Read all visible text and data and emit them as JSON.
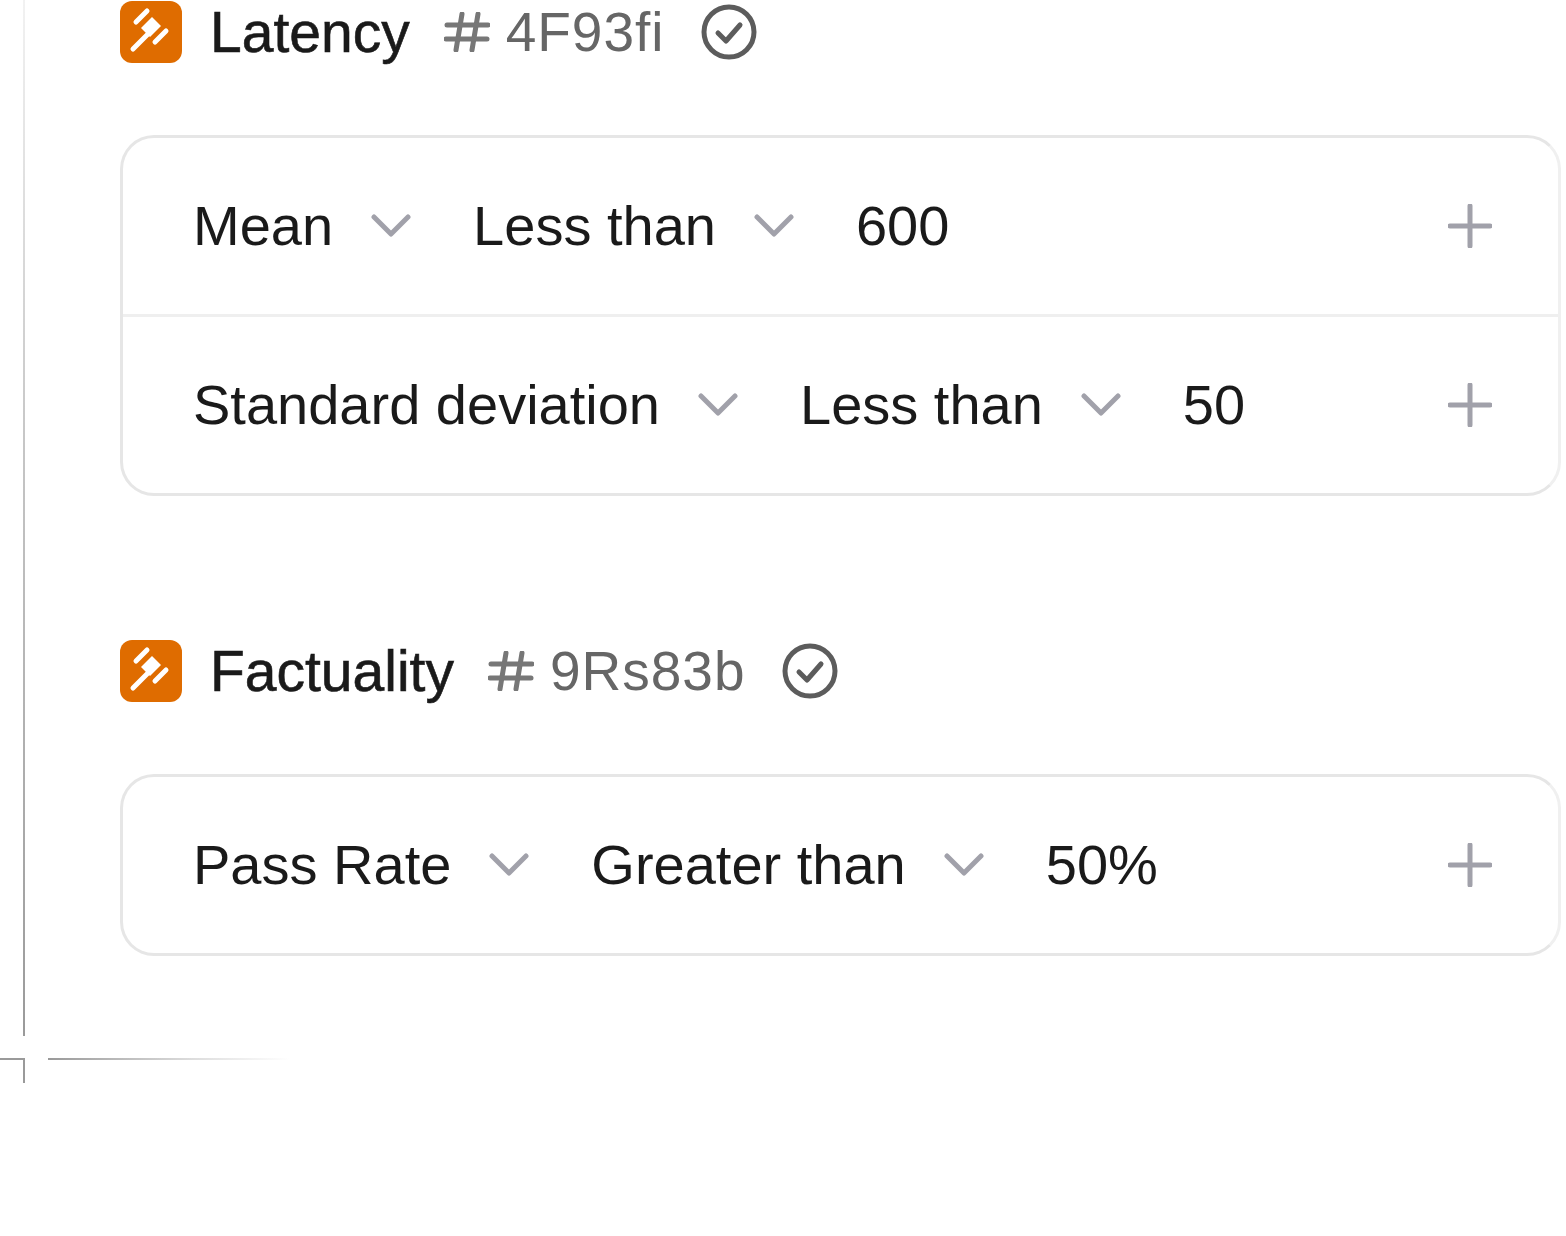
{
  "evaluators": [
    {
      "title": "Latency",
      "id": "4F93fi",
      "verified": true,
      "conditions": [
        {
          "metric": "Mean",
          "operator": "Less than",
          "value": "600"
        },
        {
          "metric": "Standard deviation",
          "operator": "Less than",
          "value": "50"
        }
      ]
    },
    {
      "title": "Factuality",
      "id": "9Rs83b",
      "verified": true,
      "conditions": [
        {
          "metric": "Pass Rate",
          "operator": "Greater than",
          "value": "50%"
        }
      ]
    }
  ]
}
